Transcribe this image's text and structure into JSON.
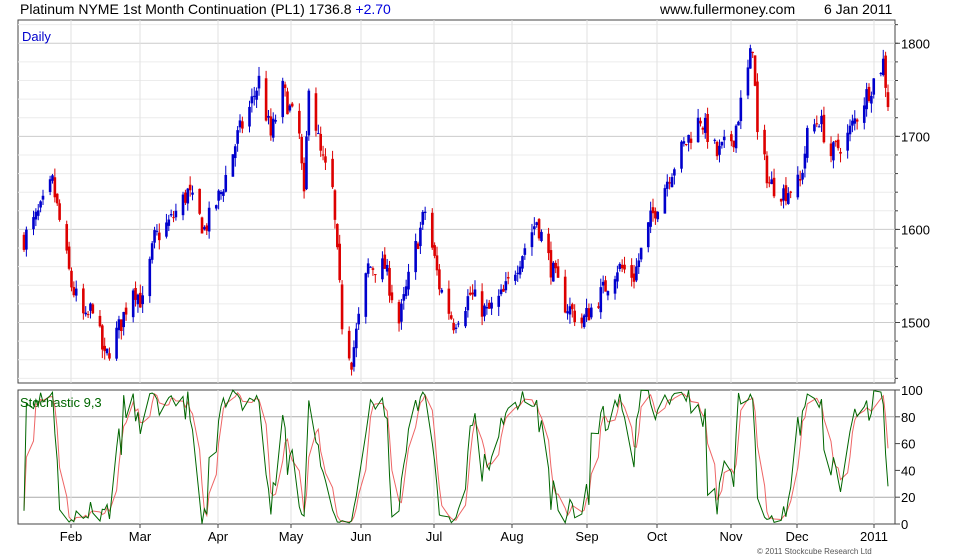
{
  "header": {
    "title": "Platinum NYME 1st Month Continuation (PL1) 1736.8",
    "change": "+2.70",
    "site": "www.fullermoney.com",
    "date": "6 Jan 2011"
  },
  "copyright": "© 2011 Stockcube Research Ltd",
  "colors": {
    "up": "#0000cc",
    "down": "#dd0000",
    "stoch_k": "#006600",
    "stoch_d": "#ee6666",
    "grid": "#cccccc"
  },
  "chart_data": [
    {
      "type": "candlestick",
      "label": "Daily",
      "yticks": [
        1500,
        1600,
        1700,
        1800
      ],
      "ylim": [
        1435,
        1825
      ],
      "x_month_labels": [
        "Feb",
        "Mar",
        "Apr",
        "May",
        "Jun",
        "Jul",
        "Aug",
        "Sep",
        "Oct",
        "Nov",
        "Dec",
        "2011"
      ],
      "x_month_positions": [
        0.12,
        0.19,
        0.32,
        0.43,
        0.52,
        0.6,
        0.72,
        0.82,
        0.92,
        1.02,
        1.1,
        1.19
      ],
      "close_path": [
        [
          "2010-01-07",
          1590
        ],
        [
          "2010-01-14",
          1620
        ],
        [
          "2010-01-19",
          1650
        ],
        [
          "2010-01-27",
          1540
        ],
        [
          "2010-02-02",
          1500
        ],
        [
          "2010-02-05",
          1520
        ],
        [
          "2010-02-10",
          1460
        ],
        [
          "2010-02-17",
          1500
        ],
        [
          "2010-02-22",
          1540
        ],
        [
          "2010-02-26",
          1520
        ],
        [
          "2010-03-03",
          1590
        ],
        [
          "2010-03-10",
          1610
        ],
        [
          "2010-03-17",
          1640
        ],
        [
          "2010-03-24",
          1600
        ],
        [
          "2010-03-31",
          1640
        ],
        [
          "2010-04-07",
          1700
        ],
        [
          "2010-04-12",
          1730
        ],
        [
          "2010-04-16",
          1760
        ],
        [
          "2010-04-21",
          1700
        ],
        [
          "2010-04-26",
          1750
        ],
        [
          "2010-05-03",
          1700
        ],
        [
          "2010-05-05",
          1630
        ],
        [
          "2010-05-07",
          1760
        ],
        [
          "2010-05-12",
          1680
        ],
        [
          "2010-05-17",
          1640
        ],
        [
          "2010-05-21",
          1500
        ],
        [
          "2010-05-25",
          1460
        ],
        [
          "2010-06-01",
          1560
        ],
        [
          "2010-06-08",
          1560
        ],
        [
          "2010-06-14",
          1500
        ],
        [
          "2010-06-21",
          1580
        ],
        [
          "2010-06-25",
          1620
        ],
        [
          "2010-07-01",
          1540
        ],
        [
          "2010-07-07",
          1500
        ],
        [
          "2010-07-14",
          1530
        ],
        [
          "2010-07-21",
          1510
        ],
        [
          "2010-07-28",
          1530
        ],
        [
          "2010-08-04",
          1570
        ],
        [
          "2010-08-11",
          1610
        ],
        [
          "2010-08-17",
          1560
        ],
        [
          "2010-08-23",
          1520
        ],
        [
          "2010-08-30",
          1500
        ],
        [
          "2010-09-07",
          1530
        ],
        [
          "2010-09-14",
          1560
        ],
        [
          "2010-09-21",
          1550
        ],
        [
          "2010-09-28",
          1610
        ],
        [
          "2010-10-06",
          1660
        ],
        [
          "2010-10-12",
          1690
        ],
        [
          "2010-10-19",
          1720
        ],
        [
          "2010-10-26",
          1680
        ],
        [
          "2010-11-02",
          1700
        ],
        [
          "2010-11-08",
          1770
        ],
        [
          "2010-11-10",
          1800
        ],
        [
          "2010-11-12",
          1700
        ],
        [
          "2010-11-17",
          1650
        ],
        [
          "2010-11-23",
          1640
        ],
        [
          "2010-11-30",
          1650
        ],
        [
          "2010-12-03",
          1700
        ],
        [
          "2010-12-08",
          1720
        ],
        [
          "2010-12-13",
          1680
        ],
        [
          "2010-12-20",
          1700
        ],
        [
          "2010-12-27",
          1740
        ],
        [
          "2011-01-04",
          1780
        ],
        [
          "2011-01-06",
          1737
        ]
      ]
    },
    {
      "type": "line",
      "label": "Stochastic 9,3",
      "yticks": [
        0,
        20,
        40,
        60,
        80,
        100
      ],
      "ylim": [
        0,
        100
      ],
      "series": [
        {
          "role": "k",
          "color": "#006600"
        },
        {
          "role": "d",
          "color": "#ee6666"
        }
      ]
    }
  ]
}
